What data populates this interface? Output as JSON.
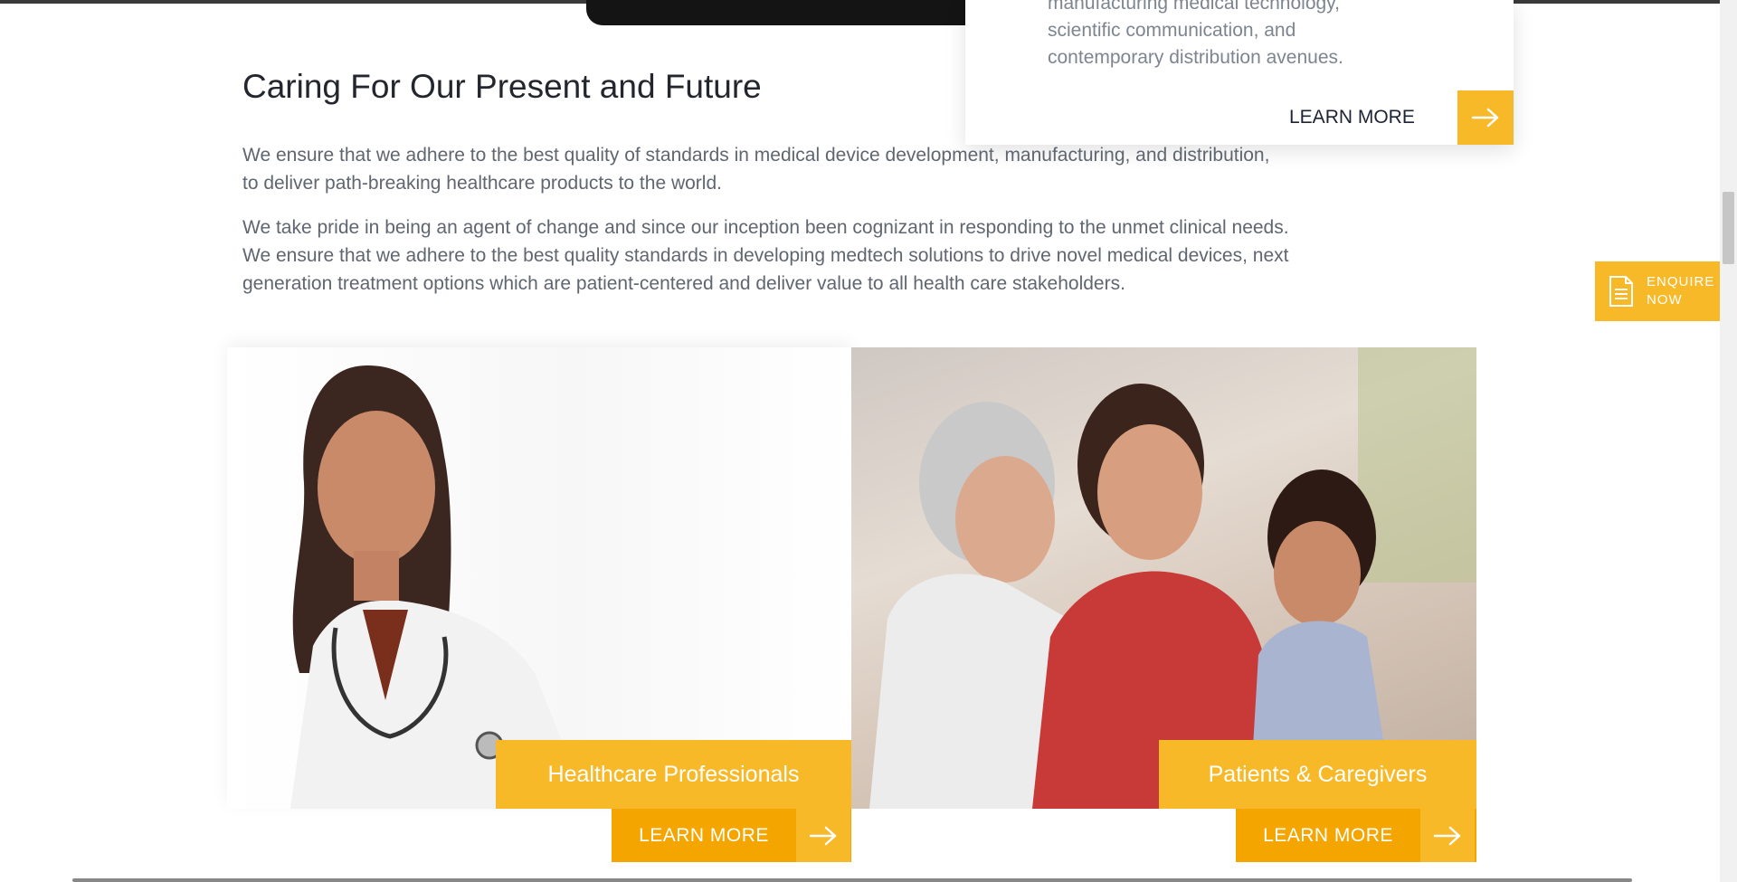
{
  "floating_card": {
    "lines": [
      "manufacturing medical technology,",
      "scientific communication, and",
      "contemporary distribution avenues."
    ],
    "learn_more": "LEARN MORE",
    "arrow_icon": "arrow-right-icon"
  },
  "section": {
    "heading": "Caring For Our Present and Future",
    "paragraph1": [
      "We ensure that we adhere to the best quality of standards in medical device development, manufacturing, and distribution,",
      "to deliver path-breaking healthcare products to the world."
    ],
    "paragraph2": [
      "We take pride in being an agent of change and since our inception been cognizant in responding to the unmet clinical needs.",
      "We ensure that we adhere to the best quality standards in developing medtech solutions to drive novel medical devices, next",
      "generation treatment options which are patient-centered and deliver value to all health care stakeholders."
    ]
  },
  "enquire": {
    "line1": "ENQUIRE",
    "line2": "NOW",
    "icon": "document-icon"
  },
  "cards": {
    "hcp": {
      "label": "Healthcare Professionals",
      "learn_more": "LEARN MORE"
    },
    "patients": {
      "label": "Patients & Caregivers",
      "learn_more": "LEARN MORE"
    }
  },
  "colors": {
    "accent": "#f7b928",
    "accent_dark": "#f5a500",
    "heading": "#23272d",
    "body_text": "#5f6670"
  }
}
